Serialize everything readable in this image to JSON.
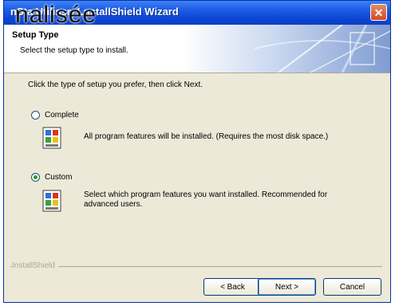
{
  "window": {
    "title": "nSta Utilissr- LnstallShield Wizard",
    "title_overlay": "nalisée",
    "close_glyph": "✕"
  },
  "header": {
    "title": "Setup Type",
    "subtitle": "Select the setup type to install."
  },
  "instruction": "Click the type of setup you prefer, then click Next.",
  "options": [
    {
      "label": "Complete",
      "selected": false,
      "icon": "setup-program-icon",
      "description_lines": [
        "All program features will be installed. (Requires the most disk space.)"
      ]
    },
    {
      "label": "Custom",
      "selected": true,
      "icon": "setup-program-icon",
      "description_lines": [
        "Select which program features you want installed. Recommended for",
        "advanced users."
      ]
    }
  ],
  "branding": "InstallShield",
  "buttons": {
    "back": "< Back",
    "next": "Next >",
    "cancel": "Cancel"
  },
  "colors": {
    "titlebar": "#0b45d4",
    "dialog_bg": "#ece9d8",
    "close_button": "#d44a20",
    "radio_dot": "#21a121"
  }
}
